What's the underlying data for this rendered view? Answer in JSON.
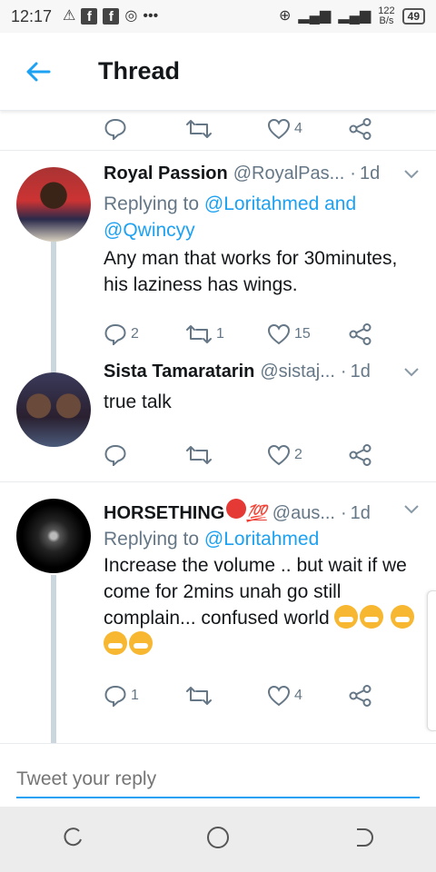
{
  "status_bar": {
    "time": "12:17",
    "network_speed_value": "122",
    "network_speed_unit": "B/s",
    "battery": "49"
  },
  "header": {
    "title": "Thread"
  },
  "top_partial_tweet": {
    "likes": "4"
  },
  "tweets": [
    {
      "name": "Royal Passion",
      "handle": "@RoyalPas...",
      "time": "1d",
      "replying_prefix": "Replying to",
      "replying_to": "@Loritahmed and",
      "replying_to_2": "@Qwincyy",
      "text": "Any man that works for 30minutes, his laziness has wings.",
      "replies": "2",
      "retweets": "1",
      "likes": "15"
    },
    {
      "name": "Sista Tamaratarin",
      "handle": "@sistaj...",
      "time": "1d",
      "text": "true talk",
      "replies": "",
      "retweets": "",
      "likes": "2"
    },
    {
      "name": "HORSETHING",
      "name_emoji_1": "red-circle",
      "name_emoji_2": "💯",
      "handle": "@aus...",
      "time": "1d",
      "replying_prefix": "Replying to",
      "replying_to": "@Loritahmed",
      "text": "Increase the volume .. but wait if we come for 2mins unah go still complain... confused world",
      "text_emoji": "face-with-steam-from-nose x5",
      "replies": "1",
      "retweets": "",
      "likes": "4"
    }
  ],
  "reply_bar": {
    "placeholder": "Tweet your reply"
  },
  "icons": {
    "back": "arrow-left-icon",
    "reply": "speech-bubble-icon",
    "retweet": "retweet-icon",
    "like": "heart-icon",
    "share": "share-icon",
    "caret": "chevron-down-icon"
  },
  "colors": {
    "accent": "#1da1f2",
    "secondary_text": "#657786",
    "thread_line": "#ccd6dd"
  }
}
